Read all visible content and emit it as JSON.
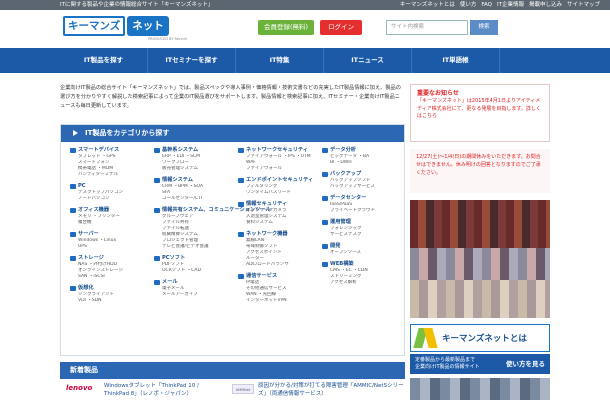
{
  "topbar": {
    "tagline": "ITに関する製品や企業の情報総合サイト「キーマンズネット」",
    "links": [
      "キーマンズネットとは",
      "使い方",
      "FAQ",
      "IT企業情報",
      "掲載申し込み",
      "サイトマップ"
    ]
  },
  "header": {
    "logo_main": "キーマンズ",
    "logo_net": "ネット",
    "produced_by": "PRODUCED BY Recruit",
    "register": "会員登録(無料)",
    "login": "ログイン",
    "search_placeholder": "サイト内検索",
    "search_button": "検索"
  },
  "nav": [
    "IT製品を探す",
    "ITセミナーを探す",
    "IT特集",
    "ITニュース",
    "IT単語帳"
  ],
  "intro": "企業向けIT製品の総合サイト「キーマンズネット」では、製品スペックや導入事例・価格情報・技術文書などの充実したIT製品情報に加え、製品の選び方を分かりやすく解説した検索記事によって企業のIT製品選びをサポートします。製品情報と検索記事に加え、ITセミナー・企業向けIT製品ニュースも毎日更新しています。",
  "categories_title": "IT製品をカテゴリから探す",
  "categories": [
    {
      "title": "スマートデバイス",
      "subs": [
        "タブレット ・GPS",
        "スマートフォン",
        "携帯電話 ・MDM",
        "ハンディターミナル"
      ]
    },
    {
      "title": "PC",
      "subs": [
        "デスクトップパソコン",
        "ノートパソコン"
      ]
    },
    {
      "title": "オフィス機器",
      "subs": [
        "メモリ ・プリンター",
        "複合機"
      ]
    },
    {
      "title": "サーバー",
      "subs": [
        "Windows ・Linux",
        "UPS"
      ]
    },
    {
      "title": "ストレージ",
      "subs": [
        "NAS ・外付けHDD",
        "オンラインストレージ",
        "SAN ・iSCSI"
      ]
    },
    {
      "title": "仮想化",
      "subs": [
        "シンクライアント",
        "VDI ・SDN"
      ]
    },
    {
      "title": "基幹系システム",
      "subs": [
        "ERP ・EDI ・SCM",
        "ワークフロー",
        "販売管理システム"
      ]
    },
    {
      "title": "情報システム",
      "subs": [
        "CRM ・BPM ・SOA",
        "SFA",
        "コールセンター/CTI"
      ]
    },
    {
      "title": "情報共有システム、コミュニケーションツール",
      "subs": [
        "グループウェア",
        "ファイル共有",
        "ファイル転送",
        "経費精算システム",
        "プロジェクト管理",
        "テレビ会議/ビデオ会議"
      ]
    },
    {
      "title": "PCソフト",
      "subs": [
        "PDFソフト",
        "OCRソフト ・CAD"
      ]
    },
    {
      "title": "メール",
      "subs": [
        "電子メール",
        "メールアーカイブ"
      ]
    },
    {
      "title": "ネットワークセキュリティ",
      "subs": [
        "ファイアウォール ・IPS ・UTM",
        "WAF",
        "ファイアウォール"
      ]
    },
    {
      "title": "エンドポイントセキュリティ",
      "subs": [
        "フィルタリング",
        "ワンタイムパスワード"
      ]
    },
    {
      "title": "情報セキュリティ",
      "subs": [
        "ネットワークカメラ",
        "入退室管理システム",
        "食料システム"
      ]
    },
    {
      "title": "ネットワーク機器",
      "subs": [
        "無線LAN",
        "帯域制御ソフト",
        "アクセスポイント",
        "ルーター",
        "ADC/ロードバランサ"
      ]
    },
    {
      "title": "通信サービス",
      "subs": [
        "IP電話",
        "その他通信サービス",
        "WAN ・光回線",
        "インターネットVPN"
      ]
    },
    {
      "title": "データ分析",
      "subs": [
        "ビッグデータ ・BA",
        "BI ・DWH"
      ]
    },
    {
      "title": "バックアップ",
      "subs": [
        "バックアップソフト",
        "バックアップサービス"
      ]
    },
    {
      "title": "データセンター",
      "subs": [
        "IaaS/PaaS",
        "プライベートクラウド"
      ]
    },
    {
      "title": "運用管理",
      "subs": [
        "フォレンジック",
        "サービスデスク"
      ]
    },
    {
      "title": "開発",
      "subs": [
        "オープンソース"
      ]
    },
    {
      "title": "WEB構築",
      "subs": [
        "CMS ・EC ・CDN",
        "ストリーミング",
        "アクセス解析"
      ]
    }
  ],
  "new_products_title": "新着製品",
  "new_products": [
    {
      "brand": "lenovo",
      "text": "Windowsタブレット「ThinkPad 10 / ThinkPad 8」（レノボ・ジャパン）"
    },
    {
      "brand": "AMMNet",
      "text": "原因が分かる/対策が打てる障害管理「AMMIC/NetSシリーズ」（両通信情報サービス）"
    }
  ],
  "notice1": {
    "title": "重要なお知らせ",
    "body": "「キーマンズネット」は2015年4月1日よりアイティメディア株式会社にて、更なる発展を目指します。詳しくはこちら"
  },
  "notice2": {
    "body": "12/27(土)〜1/4(日)の期間休みをいただきます。お問合せはできません。休み明けの回答となりますのでご了承ください。"
  },
  "banner": {
    "title": "キーマンズネットとは",
    "sub1": "定番製品から最新製品まで",
    "sub2": "企業向けIT製品の情報サイト",
    "howto": "使い方を見る"
  }
}
